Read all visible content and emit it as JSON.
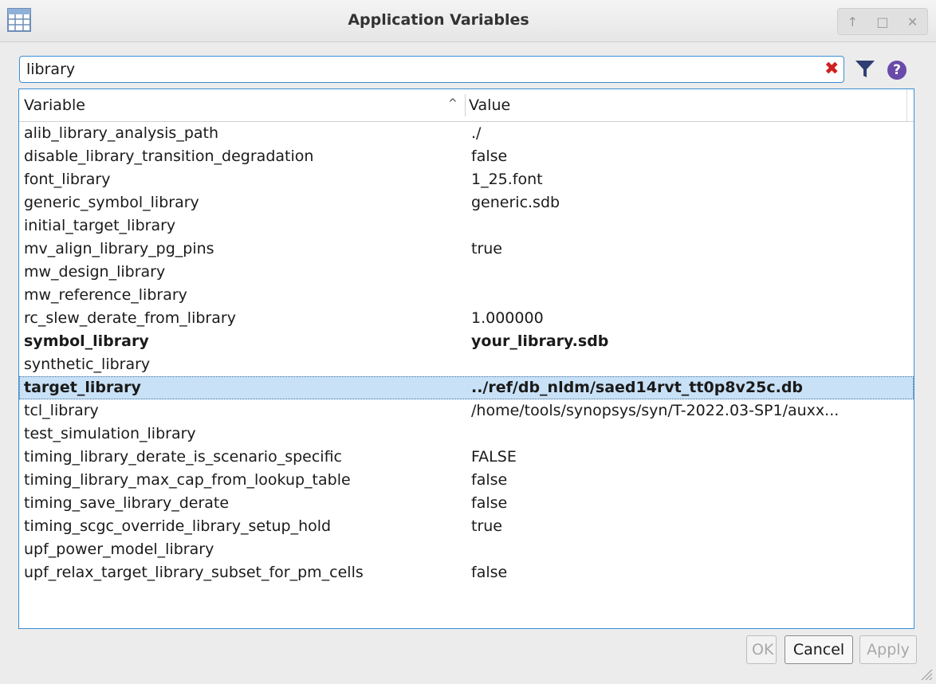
{
  "window": {
    "title": "Application Variables",
    "controls": [
      "↑",
      "□",
      "✕"
    ]
  },
  "search": {
    "value": "library",
    "clear_glyph": "✖",
    "help_glyph": "?"
  },
  "table": {
    "columns": {
      "variable": "Variable",
      "value": "Value",
      "sort_glyph": "^"
    },
    "rows": [
      {
        "name": "alib_library_analysis_path",
        "value": "./"
      },
      {
        "name": "disable_library_transition_degradation",
        "value": "false"
      },
      {
        "name": "font_library",
        "value": "1_25.font"
      },
      {
        "name": "generic_symbol_library",
        "value": "generic.sdb"
      },
      {
        "name": "initial_target_library",
        "value": ""
      },
      {
        "name": "mv_align_library_pg_pins",
        "value": "true"
      },
      {
        "name": "mw_design_library",
        "value": ""
      },
      {
        "name": "mw_reference_library",
        "value": ""
      },
      {
        "name": "rc_slew_derate_from_library",
        "value": "1.000000"
      },
      {
        "name": "symbol_library",
        "value": "your_library.sdb",
        "bold": true
      },
      {
        "name": "synthetic_library",
        "value": ""
      },
      {
        "name": "target_library",
        "value": "../ref/db_nldm/saed14rvt_tt0p8v25c.db",
        "bold": true,
        "selected": true
      },
      {
        "name": "tcl_library",
        "value": "/home/tools/synopsys/syn/T-2022.03-SP1/auxx..."
      },
      {
        "name": "test_simulation_library",
        "value": ""
      },
      {
        "name": "timing_library_derate_is_scenario_specific",
        "value": "FALSE"
      },
      {
        "name": "timing_library_max_cap_from_lookup_table",
        "value": "false"
      },
      {
        "name": "timing_save_library_derate",
        "value": "false"
      },
      {
        "name": "timing_scgc_override_library_setup_hold",
        "value": "true"
      },
      {
        "name": "upf_power_model_library",
        "value": ""
      },
      {
        "name": "upf_relax_target_library_subset_for_pm_cells",
        "value": "false"
      }
    ]
  },
  "buttons": {
    "ok": "OK",
    "cancel": "Cancel",
    "apply": "Apply"
  }
}
